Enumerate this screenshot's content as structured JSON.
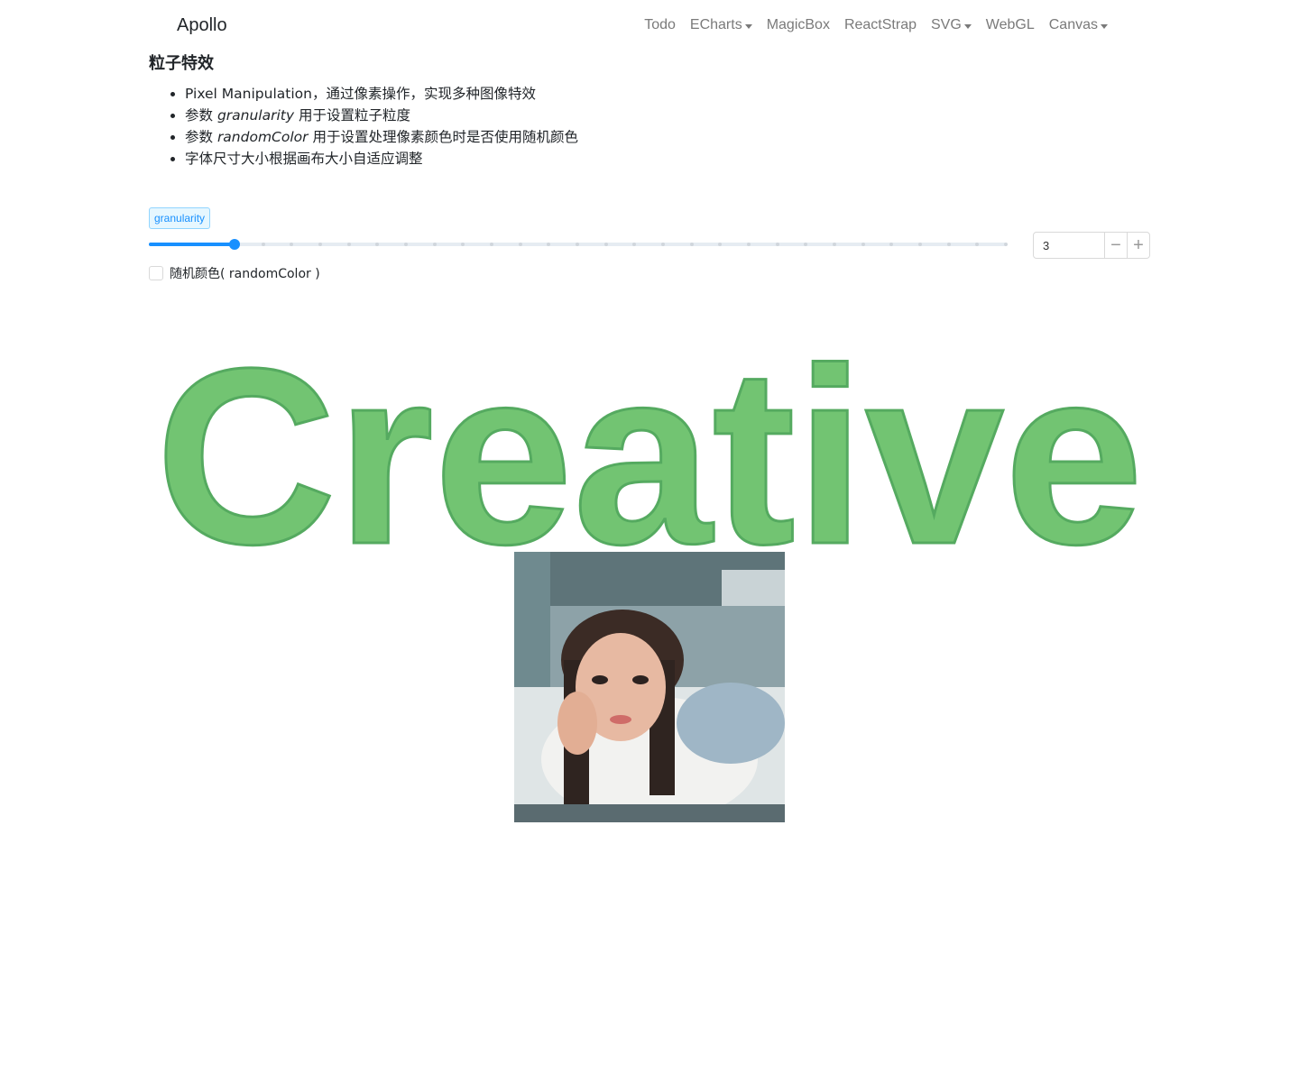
{
  "navbar": {
    "brand": "Apollo",
    "links": [
      {
        "label": "Todo",
        "dropdown": false
      },
      {
        "label": "ECharts",
        "dropdown": true
      },
      {
        "label": "MagicBox",
        "dropdown": false
      },
      {
        "label": "ReactStrap",
        "dropdown": false
      },
      {
        "label": "SVG",
        "dropdown": true
      },
      {
        "label": "WebGL",
        "dropdown": false
      },
      {
        "label": "Canvas",
        "dropdown": true
      }
    ]
  },
  "page": {
    "title": "粒子特效",
    "bullets": [
      {
        "pre": "Pixel Manipulation，通过像素操作，实现多种图像特效",
        "em": "",
        "post": ""
      },
      {
        "pre": "参数 ",
        "em": "granularity",
        "post": " 用于设置粒子粒度"
      },
      {
        "pre": "参数 ",
        "em": "randomColor",
        "post": " 用于设置处理像素颜色时是否使用随机颜色"
      },
      {
        "pre": "字体尺寸大小根据画布大小自适应调整",
        "em": "",
        "post": ""
      }
    ]
  },
  "controls": {
    "granularity_tag": "granularity",
    "granularity_value": "3",
    "slider_min": 0,
    "slider_max": 30,
    "slider_value": 3,
    "decrement_symbol": "−",
    "increment_symbol": "+",
    "random_color_label": "随机颜色( randomColor )",
    "random_color_checked": false
  },
  "canvas": {
    "text": "Creative",
    "text_color": "#72c472",
    "photo_alt": "pixelated portrait photo"
  },
  "colors": {
    "accent": "#1890ff",
    "nav_text": "#7a7a7a"
  }
}
